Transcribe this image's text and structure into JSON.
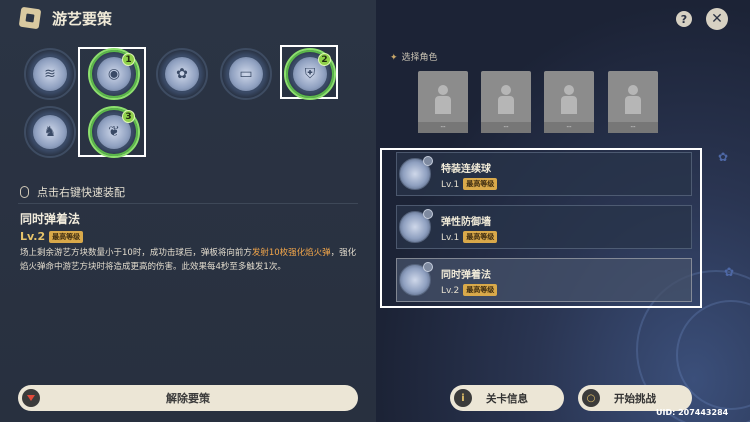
{
  "header": {
    "title": "游艺要策"
  },
  "strategies": [
    {
      "name": "strategy-1",
      "icon": "wind-bell-icon",
      "selected": false
    },
    {
      "name": "strategy-2",
      "icon": "chain-ball-icon",
      "selected": true,
      "order": "1"
    },
    {
      "name": "strategy-3",
      "icon": "flower-ball-icon",
      "selected": false
    },
    {
      "name": "strategy-4",
      "icon": "wall-icon",
      "selected": false
    },
    {
      "name": "strategy-5",
      "icon": "shield-icon",
      "selected": true,
      "order": "2"
    },
    {
      "name": "strategy-6",
      "icon": "boot-icon",
      "selected": false
    },
    {
      "name": "strategy-7",
      "icon": "feather-icon",
      "selected": true,
      "order": "3"
    }
  ],
  "hint": "点击右键快速装配",
  "detail": {
    "name": "同时弹着法",
    "level": "Lv.2",
    "level_tag": "最高等级",
    "desc_before": "场上剩余游艺方块数量小于10时，成功击球后，弹板将向前方",
    "desc_highlight": "发射10枚强化焰火弹",
    "desc_after": "，强化焰火弹命中游艺方块时将造成更高的伤害。此效果每4秒至多触发1次。"
  },
  "remove_button": "解除要策",
  "controls": {
    "help": "?",
    "close": "✕"
  },
  "select_characters": {
    "title": "选择角色",
    "slots": [
      "--",
      "--",
      "--",
      "--"
    ]
  },
  "equipped": [
    {
      "name": "特装连续球",
      "level": "Lv.1",
      "tag": "最高等级"
    },
    {
      "name": "弹性防御墙",
      "level": "Lv.1",
      "tag": "最高等级"
    },
    {
      "name": "同时弹着法",
      "level": "Lv.2",
      "tag": "最高等级"
    }
  ],
  "buttons": {
    "stage_info": "关卡信息",
    "start": "开始挑战",
    "stage_icon": "i",
    "start_icon": "○"
  },
  "uid": "UID: 207443284",
  "colors": {
    "accent_green": "#8ed04a",
    "highlight_orange": "#f2a64a",
    "gold": "#d9a94a"
  }
}
